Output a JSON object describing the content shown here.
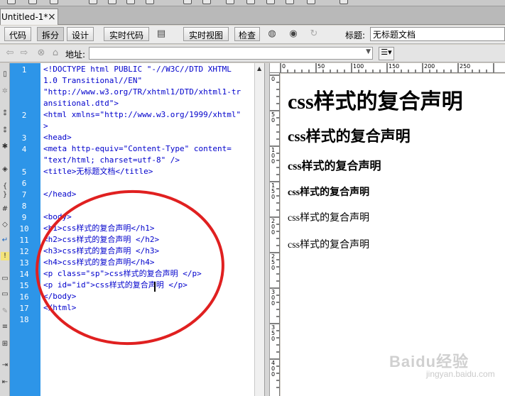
{
  "tab": {
    "title": "Untitled-1*",
    "close_glyph": "×"
  },
  "toolbar": {
    "code_label": "代码",
    "split_label": "拆分",
    "design_label": "设计",
    "live_code_label": "实时代码",
    "live_view_label": "实时视图",
    "inspect_label": "检查",
    "title_label": "标题:",
    "title_value": "无标题文档"
  },
  "address": {
    "label": "地址:",
    "value": ""
  },
  "code": {
    "line_numbers": [
      "1",
      "2",
      "3",
      "4",
      "5",
      "6",
      "7",
      "8",
      "9",
      "10",
      "11",
      "12",
      "13",
      "14",
      "15",
      "16",
      "17",
      "18"
    ],
    "lines": [
      "<!DOCTYPE html PUBLIC \"-//W3C//DTD XHTML",
      "1.0 Transitional//EN\"",
      "\"http://www.w3.org/TR/xhtml1/DTD/xhtml1-tr",
      "ansitional.dtd\">",
      "<html xmlns=\"http://www.w3.org/1999/xhtml\"",
      ">",
      "<head>",
      "<meta http-equiv=\"Content-Type\" content=",
      "\"text/html; charset=utf-8\" />",
      "<title>无标题文档</title>",
      "",
      "</head>",
      "",
      "<body>",
      "<h1>css样式的复合声明</h1>",
      "<h2>css样式的复合声明 </h2>",
      "<h3>css样式的复合声明 </h3>",
      "<h4>css样式的复合声明</h4>",
      "<p class=\"sp\">css样式的复合声明 </p>",
      "<p id=\"id\">css样式的复合声明 </p>",
      "</body>",
      "</html>"
    ]
  },
  "ruler": {
    "h_marks": [
      "0",
      "50",
      "100",
      "150",
      "200",
      "250"
    ],
    "v_marks": [
      "0",
      "50",
      "100",
      "150",
      "200",
      "250",
      "300",
      "350",
      "400"
    ]
  },
  "preview": {
    "h1": "css样式的复合声明",
    "h2": "css样式的复合声明",
    "h3": "css样式的复合声明",
    "h4": "css样式的复合声明",
    "p1": "css样式的复合声明",
    "p2": "css样式的复合声明"
  },
  "watermark": {
    "brand": "Baidu经验",
    "url": "jingyan.baidu.com"
  },
  "colors": {
    "gutter": "#2d95e8",
    "code_tag": "#0000cc",
    "annotation": "#e02020"
  }
}
